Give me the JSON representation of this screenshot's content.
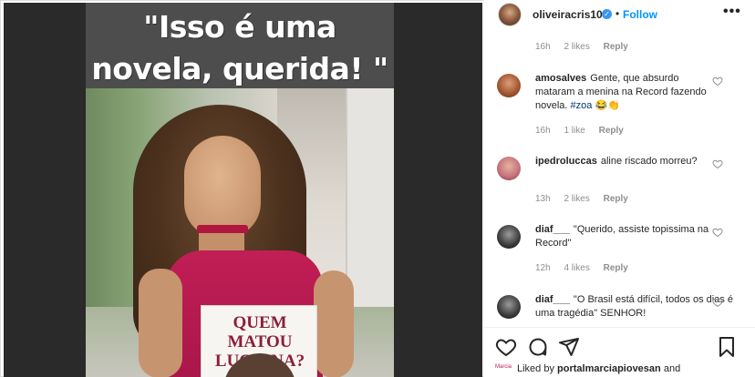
{
  "story": {
    "caption_line1": "\"Isso é uma",
    "caption_line2": "novela, querida! \"",
    "sign_line1": "QUEM MATOU",
    "sign_line2": "LUCIANA?"
  },
  "header": {
    "username": "oliveiracris10",
    "verified_mark": "✓",
    "separator": "•",
    "follow_label": "Follow",
    "more_label": "•••"
  },
  "first_meta": {
    "time": "16h",
    "likes": "2 likes",
    "reply": "Reply"
  },
  "comments": [
    {
      "user": "amosalves",
      "text": "Gente, que absurdo mataram a menina na Record fazendo novela.",
      "hashtag": "#zoa",
      "emoji": "😂👏",
      "time": "16h",
      "likes": "1 like",
      "reply": "Reply",
      "avatar_color": "#a0522d"
    },
    {
      "user": "ipedroluccas",
      "text": "aline riscado morreu?",
      "time": "13h",
      "likes": "2 likes",
      "reply": "Reply",
      "avatar_color": "#c4707a"
    },
    {
      "user": "diaf___",
      "text": "\"Querido, assiste topissima na Record\"",
      "time": "12h",
      "likes": "4 likes",
      "reply": "Reply",
      "avatar_color": "#3a3a3a"
    },
    {
      "user": "diaf___",
      "text": "\"O Brasil está difícil, todos os dias é uma tragédia\" SENHOR!",
      "avatar_color": "#3a3a3a"
    }
  ],
  "liked_by": {
    "prefix": "Liked by",
    "user": "portalmarciapiovesan",
    "suffix": "and",
    "avatar_text": "Marcia"
  },
  "icons": [
    "heart-icon",
    "comment-icon",
    "share-icon",
    "bookmark-icon"
  ]
}
